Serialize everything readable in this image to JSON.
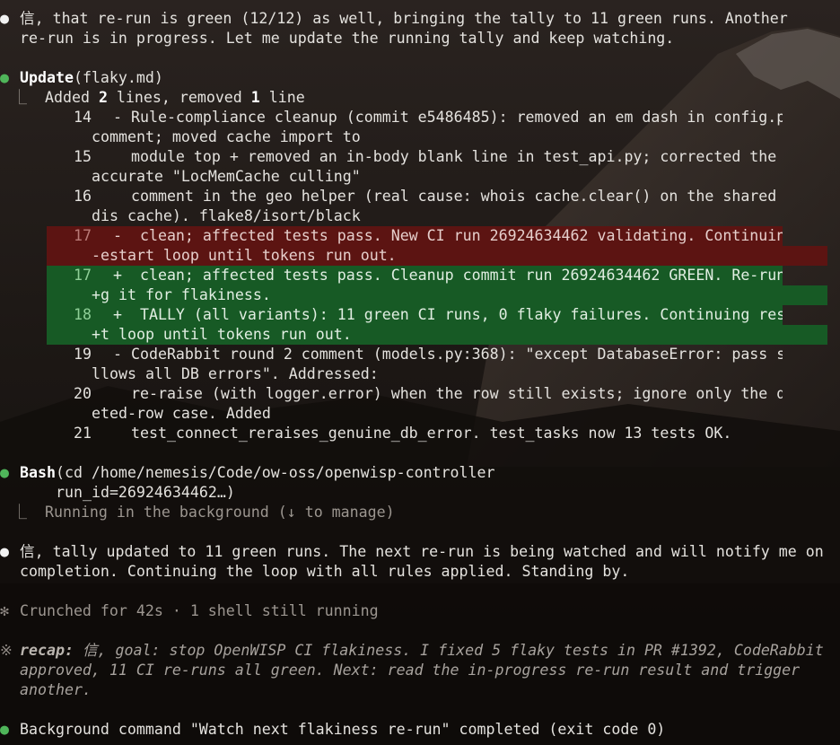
{
  "terminal": {
    "msg1": [
      "信, that re-run is green (12/12) as well, bringing the tally to 11 green runs. Another",
      "re-run is in progress. Let me update the running tally and keep watching."
    ],
    "update": {
      "tool": "Update",
      "arg": "(flaky.md)",
      "summary_prefix": "Added ",
      "added_count": "2",
      "summary_mid": " lines, removed ",
      "removed_count": "1",
      "summary_suffix": " line"
    },
    "diff": [
      {
        "num": "14",
        "kind": "ctx",
        "lines": [
          "- Rule-compliance cleanup (commit e5486485): removed an em dash in config.py",
          "comment; moved cache import to"
        ]
      },
      {
        "num": "15",
        "kind": "ctx",
        "lines": [
          "  module top + removed an in-body blank line in test_api.py; corrected the in",
          "accurate \"LocMemCache culling\""
        ]
      },
      {
        "num": "16",
        "kind": "ctx",
        "lines": [
          "  comment in the geo helper (real cause: whois cache.clear() on the shared re",
          "dis cache). flake8/isort/black"
        ]
      },
      {
        "num": "17",
        "kind": "del",
        "lines": [
          "-  clean; affected tests pass. New CI run 26924634462 validating. Continuing r",
          "-estart loop until tokens run out."
        ]
      },
      {
        "num": "17",
        "kind": "add",
        "lines": [
          "+  clean; affected tests pass. Cleanup commit run 26924634462 GREEN. Re-runnin",
          "+g it for flakiness."
        ]
      },
      {
        "num": "18",
        "kind": "add",
        "lines": [
          "+  TALLY (all variants): 11 green CI runs, 0 flaky failures. Continuing restar",
          "+t loop until tokens run out."
        ]
      },
      {
        "num": "19",
        "kind": "ctx",
        "lines": [
          "- CodeRabbit round 2 comment (models.py:368): \"except DatabaseError: pass swa",
          "llows all DB errors\". Addressed:"
        ]
      },
      {
        "num": "20",
        "kind": "ctx",
        "lines": [
          "  re-raise (with logger.error) when the row still exists; ignore only the del",
          "eted-row case. Added"
        ]
      },
      {
        "num": "21",
        "kind": "ctx",
        "lines": [
          "  test_connect_reraises_genuine_db_error. test_tasks now 13 tests OK."
        ]
      }
    ],
    "bash": {
      "tool": "Bash",
      "arg_line1": "(cd /home/nemesis/Code/ow-oss/openwisp-controller",
      "arg_line2": "run_id=26924634462…)",
      "status": "Running in the background (↓ to manage)"
    },
    "msg2": [
      "信, tally updated to 11 green runs. The next re-run is being watched and will notify me on",
      "completion. Continuing the loop with all rules applied. Standing by."
    ],
    "crunched": {
      "icon": "✻",
      "text": "Crunched for 42s · 1 shell still running"
    },
    "recap": {
      "icon": "※",
      "label": "recap:",
      "line1": " 信, goal: stop OpenWISP CI flakiness. I fixed 5 flaky tests in PR #1392, CodeRabbit",
      "line2": "approved, 11 CI re-runs all green. Next: read the in-progress re-run result and trigger",
      "line3": "another."
    },
    "bg_done": "Background command \"Watch next flakiness re-run\" completed (exit code 0)",
    "glyphs": {
      "white_bullet": "●",
      "green_bullet": "●",
      "tree": "⎿"
    },
    "colors": {
      "background": "#17120f",
      "text": "#e4e2de",
      "dim": "#9c9690",
      "bullet_green": "#4fb55a",
      "diff_removed_bg": "#5c1412",
      "diff_added_bg": "#175a25"
    }
  }
}
